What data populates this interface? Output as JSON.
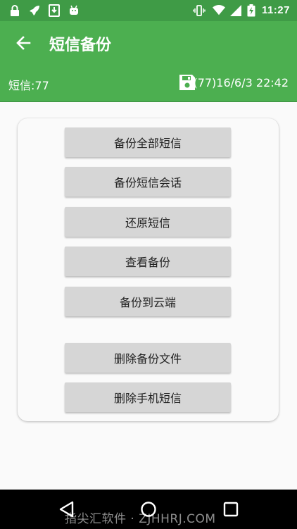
{
  "status_bar": {
    "time": "11:27",
    "left_icons": [
      "lock-icon",
      "rocket-icon",
      "download-icon",
      "android-icon"
    ],
    "right_icons": [
      "vibrate-icon",
      "wifi-icon",
      "signal-icon",
      "battery-charging-icon"
    ]
  },
  "toolbar": {
    "back_icon": "arrow-left-icon",
    "title": "短信备份"
  },
  "info_bar": {
    "sms_count": "短信:77",
    "save_icon": "save-icon",
    "last_backup": "(77)16/6/3 22:42"
  },
  "actions": {
    "backup_all": "备份全部短信",
    "backup_conversations": "备份短信会话",
    "restore": "还原短信",
    "view_backups": "查看备份",
    "backup_cloud": "备份到云端",
    "delete_backup_files": "删除备份文件",
    "delete_phone_sms": "删除手机短信"
  },
  "nav_bar": {
    "icons": [
      "back-triangle-icon",
      "home-circle-icon",
      "recents-square-icon"
    ]
  },
  "watermark": "指尖汇软件 · ZJHHRJ.COM",
  "colors": {
    "primary": "#4caf50",
    "status_bar": "#3f9b46",
    "button_bg": "#d6d6d6",
    "background": "#fafafa"
  }
}
